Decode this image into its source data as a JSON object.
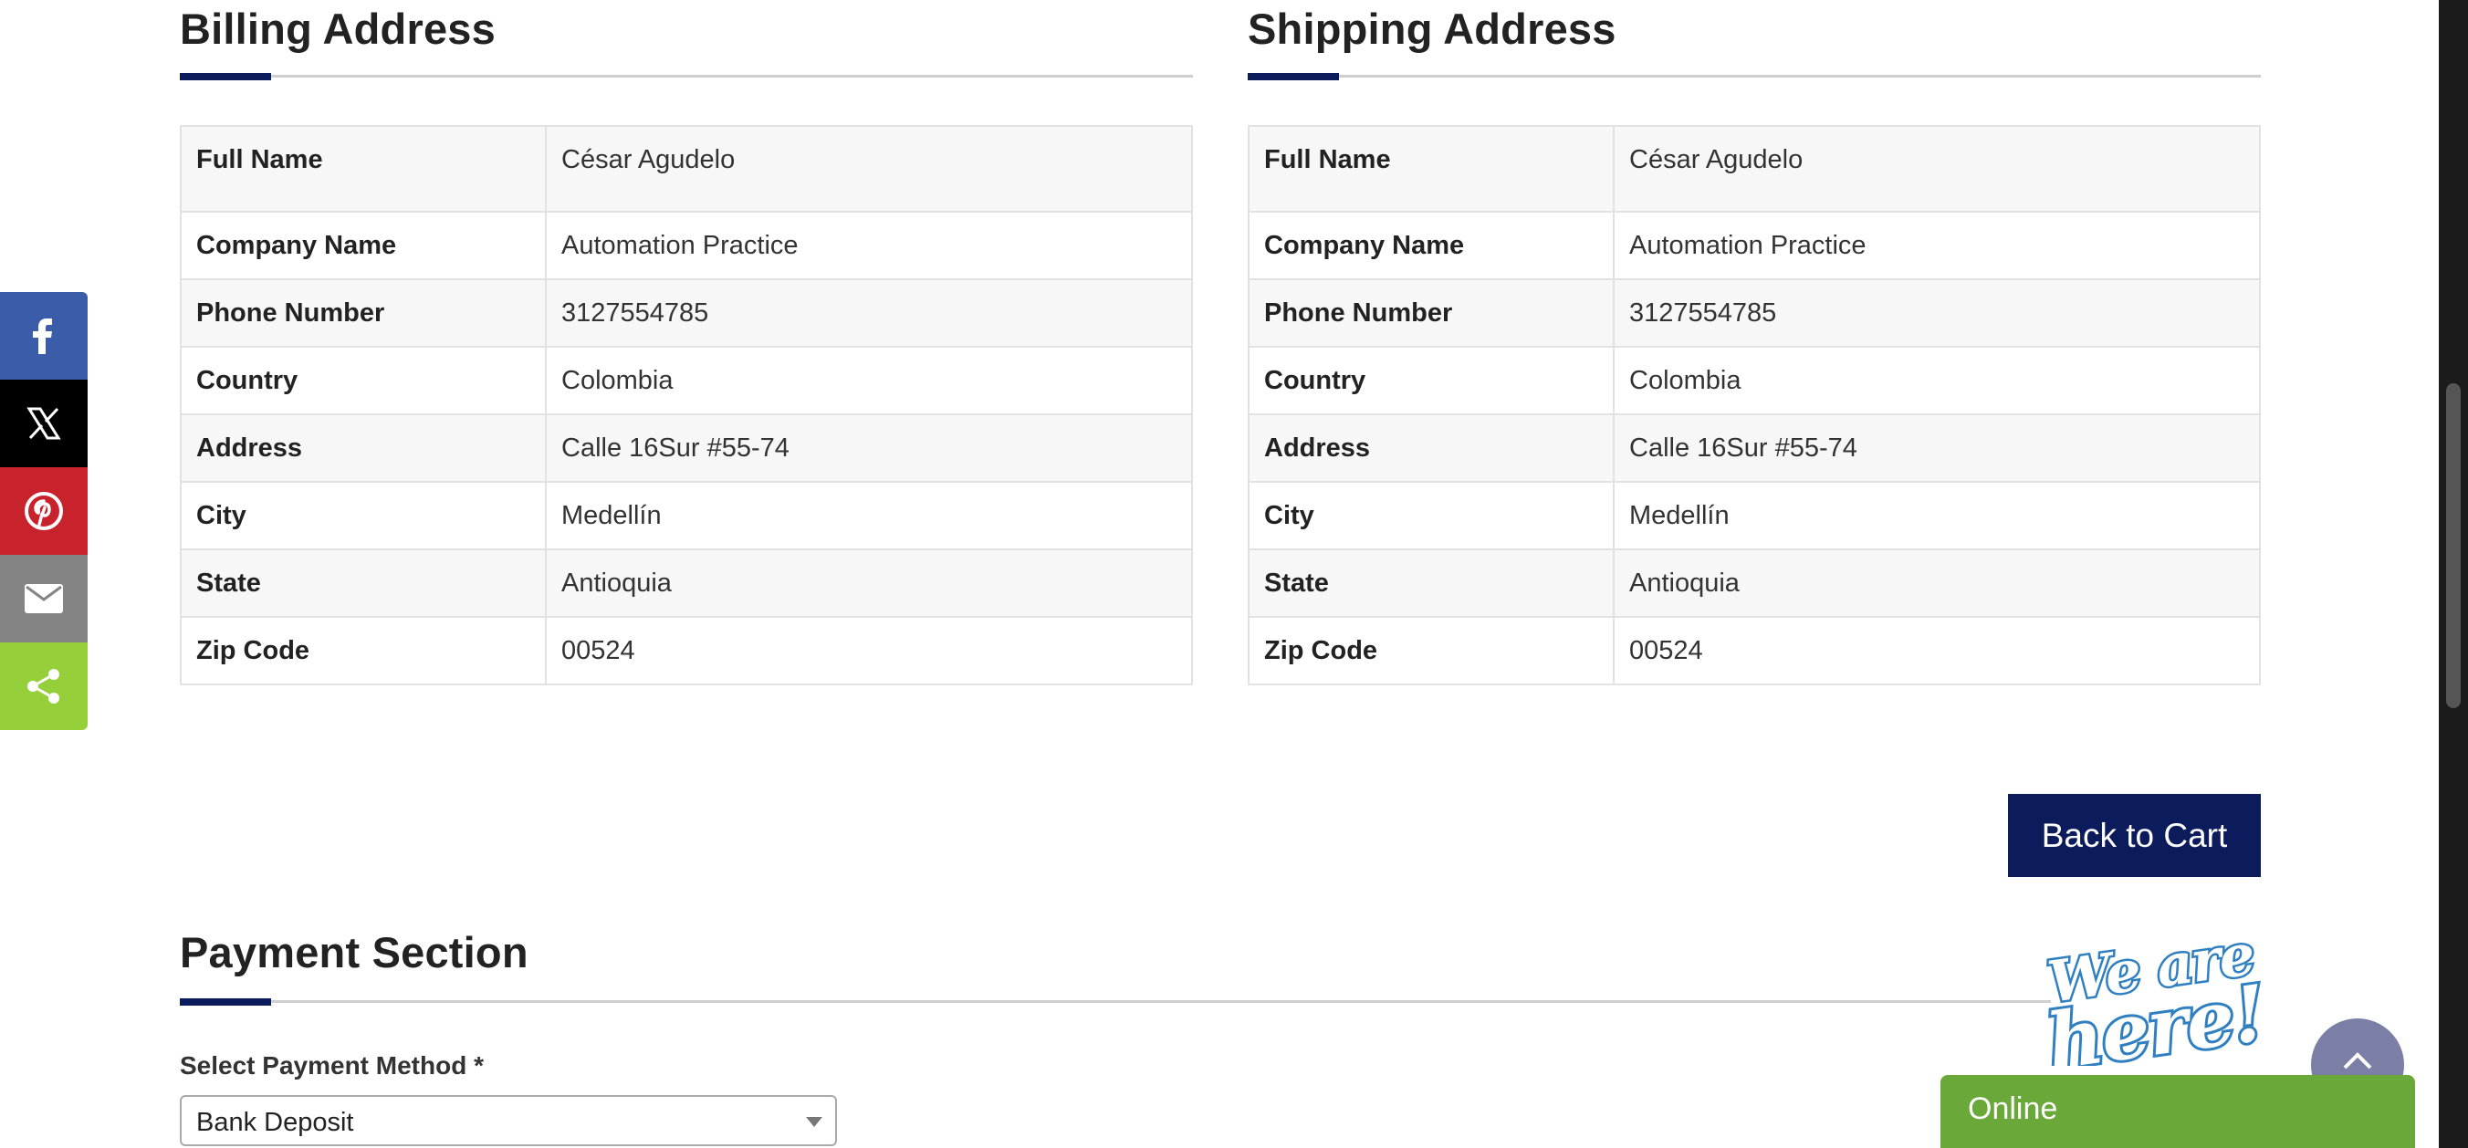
{
  "billing": {
    "title": "Billing Address",
    "rows": [
      {
        "label": "Full Name",
        "value": "César Agudelo"
      },
      {
        "label": "Company Name",
        "value": "Automation Practice"
      },
      {
        "label": "Phone Number",
        "value": "3127554785"
      },
      {
        "label": "Country",
        "value": "Colombia"
      },
      {
        "label": "Address",
        "value": "Calle 16Sur #55-74"
      },
      {
        "label": "City",
        "value": "Medellín"
      },
      {
        "label": "State",
        "value": "Antioquia"
      },
      {
        "label": "Zip Code",
        "value": "00524"
      }
    ]
  },
  "shipping": {
    "title": "Shipping Address",
    "rows": [
      {
        "label": "Full Name",
        "value": "César Agudelo"
      },
      {
        "label": "Company Name",
        "value": "Automation Practice"
      },
      {
        "label": "Phone Number",
        "value": "3127554785"
      },
      {
        "label": "Country",
        "value": "Colombia"
      },
      {
        "label": "Address",
        "value": "Calle 16Sur #55-74"
      },
      {
        "label": "City",
        "value": "Medellín"
      },
      {
        "label": "State",
        "value": "Antioquia"
      },
      {
        "label": "Zip Code",
        "value": "00524"
      }
    ]
  },
  "actions": {
    "back_to_cart": "Back to Cart"
  },
  "payment": {
    "title": "Payment Section",
    "method_label": "Select Payment Method *",
    "method_selected": "Bank Deposit"
  },
  "share": {
    "icons": [
      "facebook-icon",
      "x-twitter-icon",
      "pinterest-icon",
      "email-icon",
      "share-icon"
    ]
  },
  "chat": {
    "badge_text": "We are here!",
    "status": "Online"
  },
  "colors": {
    "accent": "#0b1b5c",
    "facebook": "#3b5ca8",
    "twitter": "#000000",
    "pinterest": "#c8232c",
    "email": "#848484",
    "share": "#95d03a",
    "chat": "#6aa83a"
  }
}
